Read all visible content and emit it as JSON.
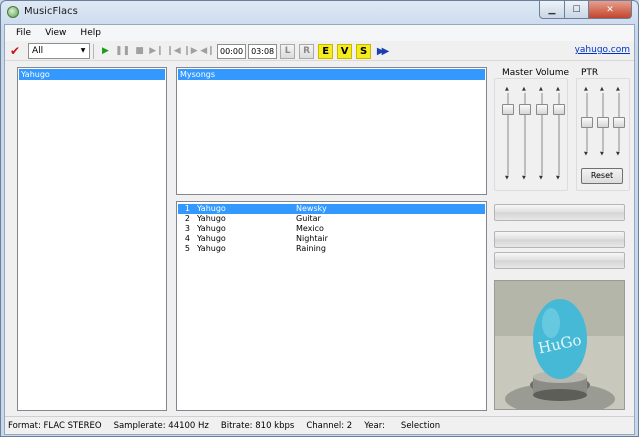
{
  "window": {
    "title": "MusicFlacs"
  },
  "menu": {
    "items": [
      "File",
      "View",
      "Help"
    ]
  },
  "toolbar": {
    "filter_value": "All",
    "time_elapsed": "00:00",
    "time_total": "03:08",
    "left_label": "L",
    "right_label": "R",
    "e_label": "E",
    "v_label": "V",
    "s_label": "S",
    "website_link": "yahugo.com"
  },
  "artists": {
    "selected": "Yahugo"
  },
  "albums": {
    "selected": "Mysongs"
  },
  "tracks": [
    {
      "num": "1",
      "artist": "Yahugo",
      "title": "Newsky",
      "selected": true
    },
    {
      "num": "2",
      "artist": "Yahugo",
      "title": "Guitar",
      "selected": false
    },
    {
      "num": "3",
      "artist": "Yahugo",
      "title": "Mexico",
      "selected": false
    },
    {
      "num": "4",
      "artist": "Yahugo",
      "title": "Nightair",
      "selected": false
    },
    {
      "num": "5",
      "artist": "Yahugo",
      "title": "Raining",
      "selected": false
    }
  ],
  "volume": {
    "label": "Master Volume",
    "levels": [
      0.85,
      0.85,
      0.85,
      0.85
    ]
  },
  "ptr": {
    "label": "PTR",
    "levels": [
      0.5,
      0.5,
      0.5
    ],
    "reset_label": "Reset"
  },
  "cover_art": {
    "text": "HuGo",
    "egg_color": "#45b9d6"
  },
  "status": {
    "format": "Format: FLAC STEREO",
    "samplerate": "Samplerate: 44100 Hz",
    "bitrate": "Bitrate: 810 kbps",
    "channel": "Channel: 2",
    "year": "Year:",
    "selection": "Selection"
  },
  "colors": {
    "selection": "#3399ff",
    "link": "#0033cc",
    "evs_button": "#f5ec1e",
    "play_icon": "#1c9c1c"
  }
}
